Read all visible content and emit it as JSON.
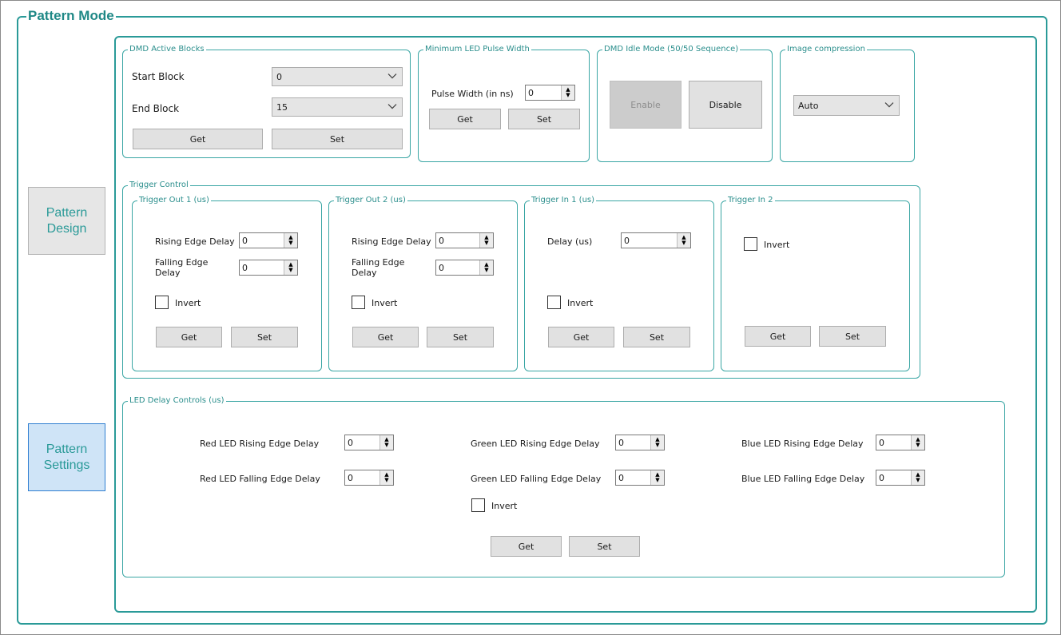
{
  "title": "Pattern Mode",
  "nav": {
    "pattern_design": "Pattern\nDesign",
    "pattern_settings": "Pattern\nSettings"
  },
  "active_blocks": {
    "legend": "DMD Active Blocks",
    "start_label": "Start Block",
    "start_value": "0",
    "end_label": "End Block",
    "end_value": "15",
    "get": "Get",
    "set": "Set"
  },
  "min_led": {
    "legend": "Minimum LED Pulse Width",
    "pulse_label": "Pulse Width (in ns)",
    "pulse_value": "0",
    "get": "Get",
    "set": "Set"
  },
  "idle_mode": {
    "legend": "DMD Idle Mode (50/50 Sequence)",
    "enable": "Enable",
    "disable": "Disable"
  },
  "compression": {
    "legend": "Image compression",
    "value": "Auto"
  },
  "trigger_control": {
    "legend": "Trigger Control",
    "out1": {
      "legend": "Trigger Out 1 (us)",
      "rising_label": "Rising Edge Delay",
      "rising_value": "0",
      "falling_label": "Falling Edge\nDelay",
      "falling_value": "0",
      "invert": "Invert",
      "get": "Get",
      "set": "Set"
    },
    "out2": {
      "legend": "Trigger Out 2 (us)",
      "rising_label": "Rising Edge Delay",
      "rising_value": "0",
      "falling_label": "Falling Edge\nDelay",
      "falling_value": "0",
      "invert": "Invert",
      "get": "Get",
      "set": "Set"
    },
    "in1": {
      "legend": "Trigger In 1 (us)",
      "delay_label": "Delay  (us)",
      "delay_value": "0",
      "invert": "Invert",
      "get": "Get",
      "set": "Set"
    },
    "in2": {
      "legend": "Trigger In 2",
      "invert": "Invert",
      "get": "Get",
      "set": "Set"
    }
  },
  "led_delay": {
    "legend": "LED Delay Controls (us)",
    "red_rising_label": "Red LED Rising Edge Delay",
    "red_rising_value": "0",
    "red_falling_label": "Red LED Falling Edge Delay",
    "red_falling_value": "0",
    "green_rising_label": "Green LED Rising Edge Delay",
    "green_rising_value": "0",
    "green_falling_label": "Green LED Falling Edge Delay",
    "green_falling_value": "0",
    "blue_rising_label": "Blue LED Rising Edge Delay",
    "blue_rising_value": "0",
    "blue_falling_label": "Blue LED Falling Edge Delay",
    "blue_falling_value": "0",
    "invert": "Invert",
    "get": "Get",
    "set": "Set"
  },
  "colors": {
    "accent": "#2a9a98",
    "button_bg": "#e1e1e1",
    "active_nav_bg": "#cfe4f7"
  }
}
